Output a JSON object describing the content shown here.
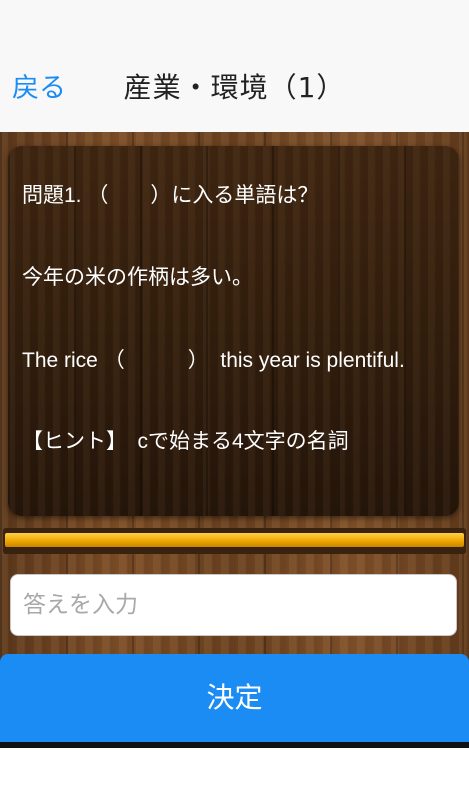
{
  "navbar": {
    "back_label": "戻る",
    "title": "産業・環境（1）"
  },
  "question": {
    "line1": "問題1. （　　）に入る単語は？",
    "line2": "今年の米の作柄は多い。",
    "line3": "The rice （　　　）  this year is plentiful.",
    "line4": "【ヒント】　cで始まる4文字の名詞"
  },
  "progress": {
    "fraction": 1.0
  },
  "answer": {
    "value": "",
    "placeholder": "答えを入力"
  },
  "submit": {
    "label": "決定"
  },
  "colors": {
    "accent": "#1a8cf4",
    "progress": "#f0a800",
    "wood": "#6a4221"
  }
}
